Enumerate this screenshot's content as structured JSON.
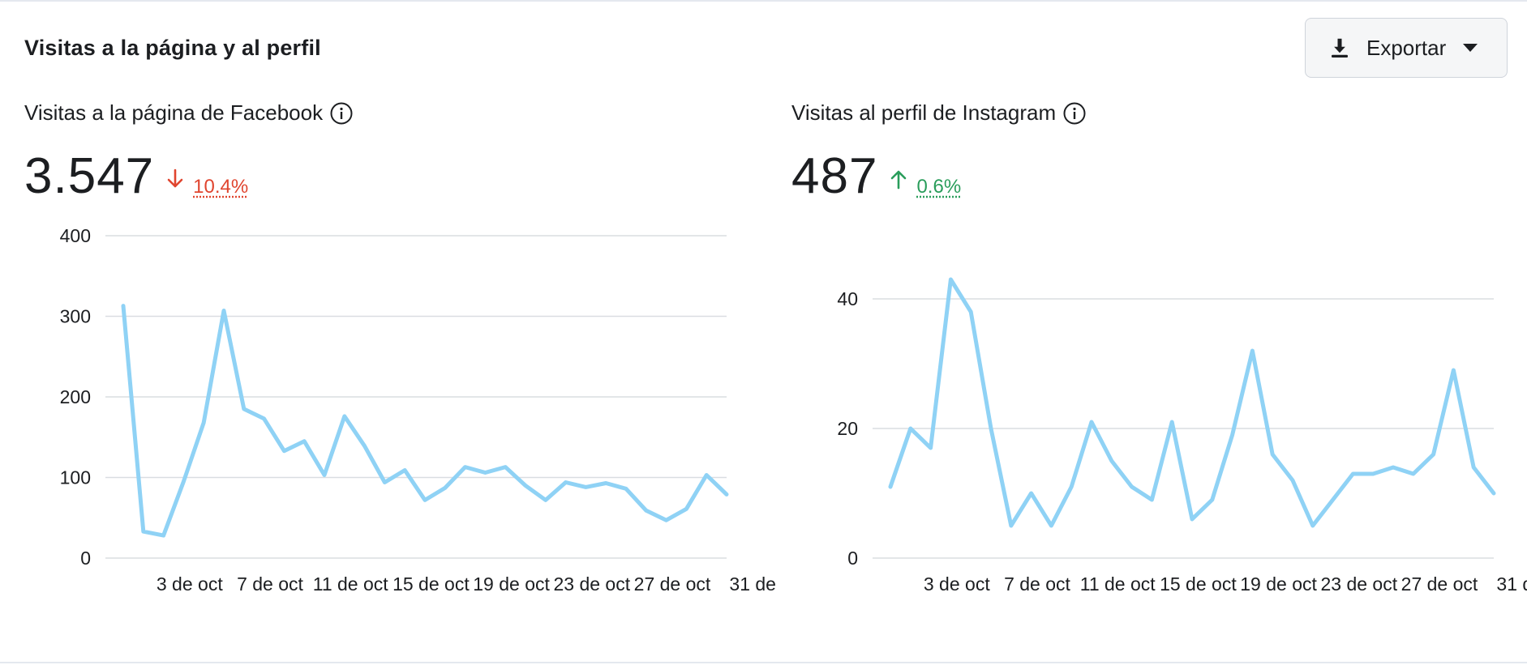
{
  "header": {
    "title": "Visitas a la página y al perfil",
    "export_label": "Exportar"
  },
  "colors": {
    "line": "#8fd2f5",
    "down": "#e0452f",
    "up": "#2a9d5b",
    "grid": "#dadde1"
  },
  "facebook": {
    "subtitle": "Visitas a la página de Facebook",
    "value": "3.547",
    "change": "10.4%",
    "direction": "down"
  },
  "instagram": {
    "subtitle": "Visitas al perfil de Instagram",
    "value": "487",
    "change": "0.6%",
    "direction": "up"
  },
  "chart_data": [
    {
      "type": "line",
      "title": "Visitas a la página de Facebook",
      "xlabel": "",
      "ylabel": "",
      "x": [
        "2 de oct",
        "3 de oct",
        "4 de oct",
        "5 de oct",
        "6 de oct",
        "7 de oct",
        "8 de oct",
        "9 de oct",
        "10 de oct",
        "11 de oct",
        "12 de oct",
        "13 de oct",
        "14 de oct",
        "15 de oct",
        "16 de oct",
        "17 de oct",
        "18 de oct",
        "19 de oct",
        "20 de oct",
        "21 de oct",
        "22 de oct",
        "23 de oct",
        "24 de oct",
        "25 de oct",
        "26 de oct",
        "27 de oct",
        "28 de oct",
        "29 de oct",
        "30 de oct",
        "31 de oct",
        "1 de nov"
      ],
      "series": [
        {
          "values": [
            313,
            33,
            28,
            95,
            168,
            307,
            185,
            173,
            133,
            145,
            103,
            176,
            139,
            94,
            109,
            72,
            87,
            113,
            106,
            113,
            90,
            72,
            94,
            88,
            93,
            86,
            59,
            47,
            61,
            103,
            79
          ]
        }
      ],
      "ylim": [
        0,
        400
      ],
      "yticks": [
        "0",
        "100",
        "200",
        "300",
        "400"
      ],
      "xtick_labels": [
        "3 de oct",
        "7 de oct",
        "11 de oct",
        "15 de oct",
        "19 de oct",
        "23 de oct",
        "27 de oct",
        "31 de"
      ],
      "grid": true
    },
    {
      "type": "line",
      "title": "Visitas al perfil de Instagram",
      "xlabel": "",
      "ylabel": "",
      "x": [
        "2 de oct",
        "3 de oct",
        "4 de oct",
        "5 de oct",
        "6 de oct",
        "7 de oct",
        "8 de oct",
        "9 de oct",
        "10 de oct",
        "11 de oct",
        "12 de oct",
        "13 de oct",
        "14 de oct",
        "15 de oct",
        "16 de oct",
        "17 de oct",
        "18 de oct",
        "19 de oct",
        "20 de oct",
        "21 de oct",
        "22 de oct",
        "23 de oct",
        "24 de oct",
        "25 de oct",
        "26 de oct",
        "27 de oct",
        "28 de oct",
        "29 de oct",
        "30 de oct",
        "31 de oct",
        "1 de nov"
      ],
      "series": [
        {
          "values": [
            11,
            20,
            17,
            43,
            38,
            20,
            5,
            10,
            5,
            11,
            21,
            15,
            11,
            9,
            21,
            6,
            9,
            19,
            32,
            16,
            12,
            5,
            9,
            13,
            13,
            14,
            13,
            16,
            29,
            14,
            10
          ]
        }
      ],
      "ylim": [
        0,
        50
      ],
      "yticks": [
        "0",
        "20",
        "40"
      ],
      "xtick_labels": [
        "3 de oct",
        "7 de oct",
        "11 de oct",
        "15 de oct",
        "19 de oct",
        "23 de oct",
        "27 de oct",
        "31 de"
      ],
      "grid": true
    }
  ]
}
